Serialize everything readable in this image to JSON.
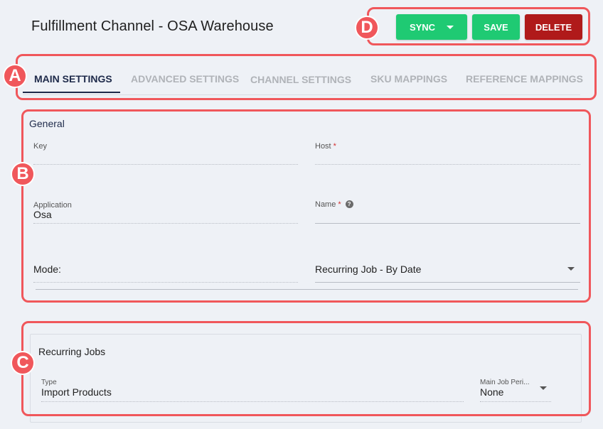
{
  "header": {
    "title": "Fulfillment Channel - OSA Warehouse",
    "sync_label": "SYNC",
    "save_label": "SAVE",
    "delete_label": "DELETE"
  },
  "tabs": [
    {
      "label": "MAIN SETTINGS",
      "active": true
    },
    {
      "label": "ADVANCED SETTINGS",
      "active": false
    },
    {
      "label": "CHANNEL SETTINGS",
      "active": false
    },
    {
      "label": "SKU MAPPINGS",
      "active": false
    },
    {
      "label": "REFERENCE MAPPINGS",
      "active": false
    }
  ],
  "general": {
    "section_title": "General",
    "key": {
      "label": "Key",
      "value": ""
    },
    "host": {
      "label": "Host",
      "required_mark": "*",
      "value": ""
    },
    "application": {
      "label": "Application",
      "value": "Osa"
    },
    "name": {
      "label": "Name",
      "required_mark": "*",
      "help_glyph": "?",
      "value": ""
    },
    "mode": {
      "label": "Mode:",
      "value": "Recurring Job - By Date"
    }
  },
  "recurring_jobs": {
    "title": "Recurring Jobs",
    "type": {
      "label": "Type",
      "value": "Import Products"
    },
    "period": {
      "label": "Main Job Peri...",
      "value": "None"
    }
  },
  "annotations": [
    {
      "letter": "A"
    },
    {
      "letter": "B"
    },
    {
      "letter": "C"
    },
    {
      "letter": "D"
    }
  ],
  "colors": {
    "accent_green": "#1fca73",
    "delete_red": "#b01a1a",
    "annotation": "#f0575b",
    "tab_active": "#1e2a4a"
  }
}
